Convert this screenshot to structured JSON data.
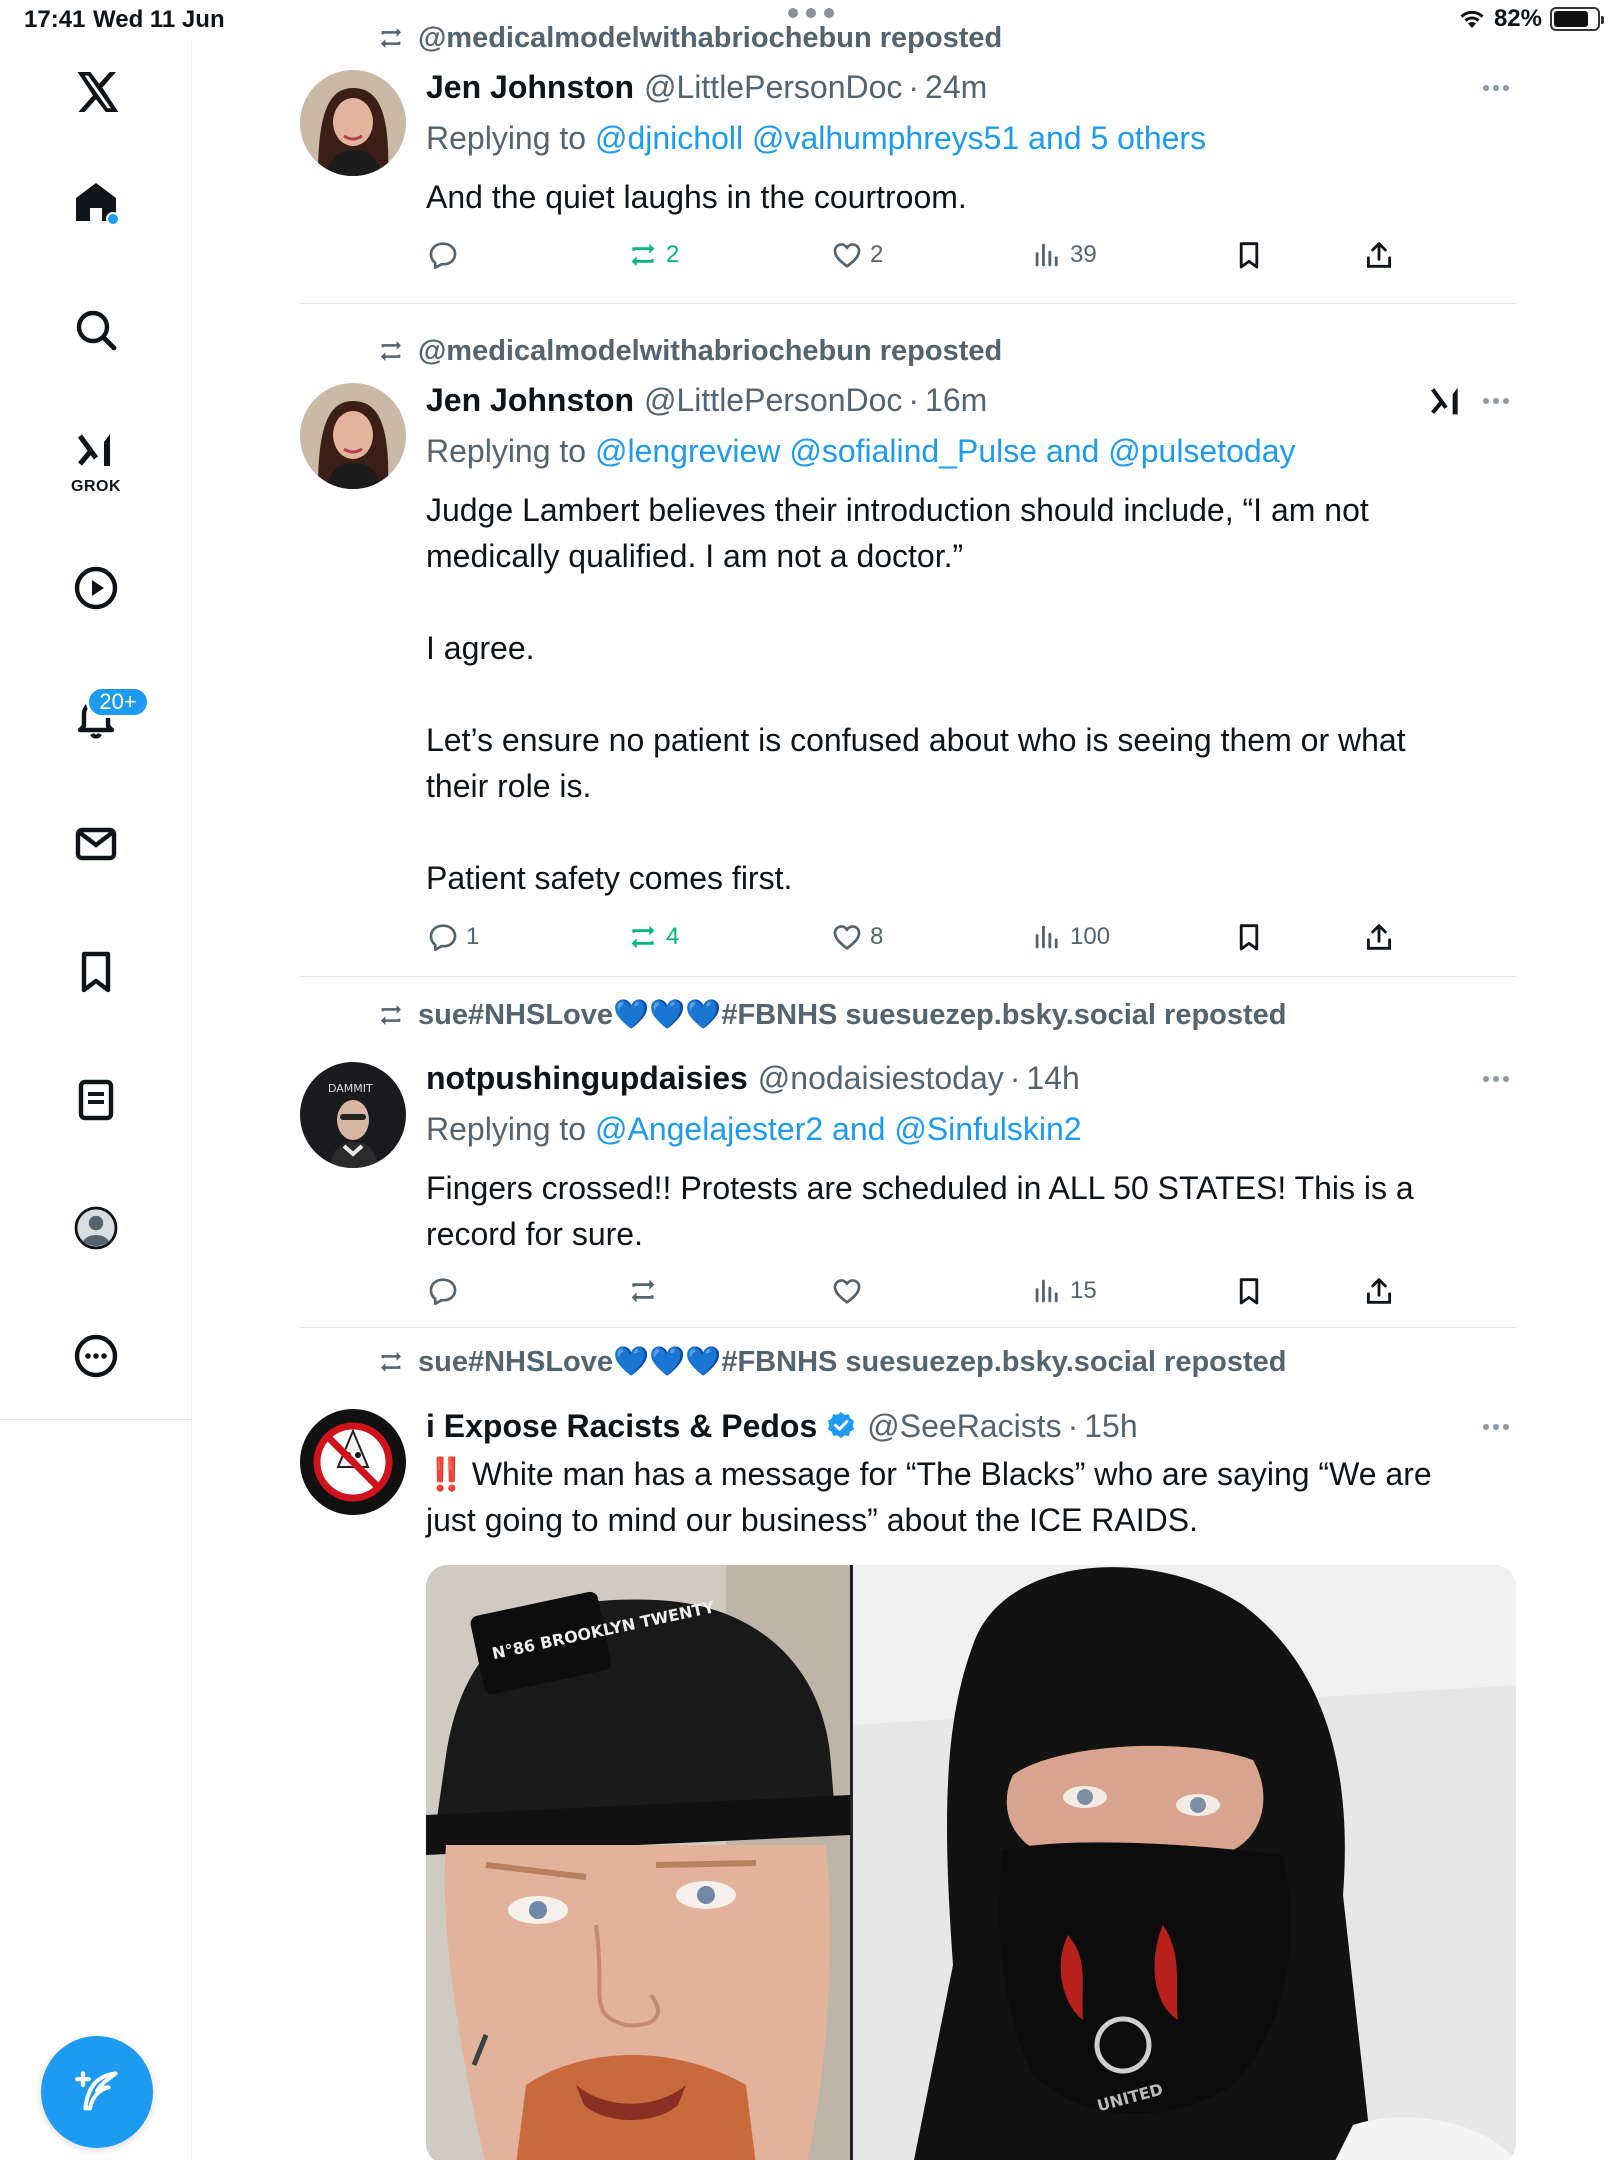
{
  "status_bar": {
    "time": "17:41",
    "date": "Wed 11 Jun",
    "battery": "82%",
    "battery_level": 0.82
  },
  "sidebar": {
    "grok_label": "GROK",
    "notifications_badge": "20+",
    "items": [
      "x-logo",
      "home",
      "search",
      "grok",
      "video",
      "notifications",
      "messages",
      "bookmarks",
      "lists",
      "profile",
      "more"
    ]
  },
  "posts": [
    {
      "reposted_by": "@medicalmodelwithabriochebun reposted",
      "name": "Jen Johnston",
      "handle": "@LittlePersonDoc",
      "sep": "·",
      "time": "24m",
      "replying_prefix": "Replying to",
      "replying_to": "@djnicholl @valhumphreys51 and 5 others",
      "text": [
        "And the quiet laughs in the courtroom."
      ],
      "replies": "",
      "reposts": "2",
      "likes": "2",
      "views": "39"
    },
    {
      "reposted_by": "@medicalmodelwithabriochebun reposted",
      "name": "Jen Johnston",
      "handle": "@LittlePersonDoc",
      "sep": "·",
      "time": "16m",
      "replying_prefix": "Replying to",
      "replying_to": "@lengreview @sofialind_Pulse and @pulsetoday",
      "text": [
        "Judge Lambert believes their introduction should include, “I am not",
        "medically qualified. I am not a doctor.”",
        "",
        "I agree.",
        "",
        "Let’s ensure no patient is confused about who is seeing them or what",
        "their role is.",
        "",
        "Patient safety comes first."
      ],
      "replies": "1",
      "reposts": "4",
      "likes": "8",
      "views": "100"
    },
    {
      "reposted_by": "sue#NHSLove💙💙💙#FBNHS suesuezep.bsky.social reposted",
      "name": "notpushingupdaisies",
      "handle": "@nodaisiestoday",
      "sep": "·",
      "time": "14h",
      "replying_prefix": "Replying to",
      "replying_to": "@Angelajester2 and @Sinfulskin2",
      "text": [
        "Fingers crossed!! Protests are scheduled in ALL 50 STATES! This is a",
        "record for sure."
      ],
      "replies": "",
      "reposts": "",
      "likes": "",
      "views": "15"
    },
    {
      "reposted_by": "sue#NHSLove💙💙💙#FBNHS suesuezep.bsky.social reposted",
      "name": "i Expose Racists & Pedos",
      "handle": "@SeeRacists",
      "sep": "·",
      "time": "15h",
      "bang": "‼️",
      "text": [
        "White man has a message for “The Blacks” who are saying “We are",
        "just going to mind our business” about the ICE RAIDS."
      ],
      "cap_text": "N°86 BROOKLYN TWENTY",
      "mask_text": "UNITED"
    }
  ],
  "colors": {
    "accent": "#1d9bf0",
    "repost_green": "#00ba7c",
    "muted": "#536471",
    "text": "#0f1419"
  }
}
